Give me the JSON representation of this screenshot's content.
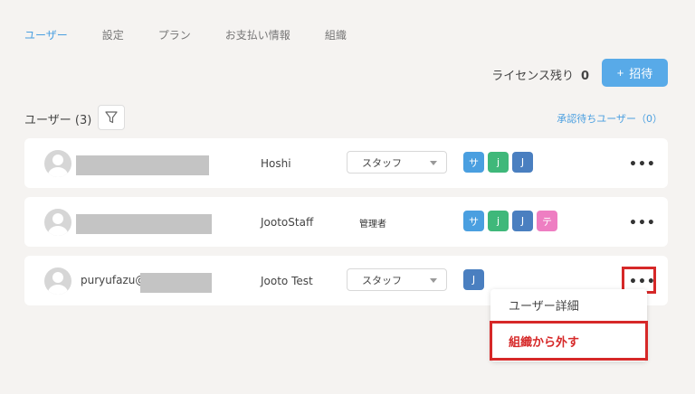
{
  "tabs": [
    {
      "label": "ユーザー",
      "active": true
    },
    {
      "label": "設定",
      "active": false
    },
    {
      "label": "プラン",
      "active": false
    },
    {
      "label": "お支払い情報",
      "active": false
    },
    {
      "label": "組織",
      "active": false
    }
  ],
  "license": {
    "label": "ライセンス残り",
    "count": "0"
  },
  "invite_button": {
    "plus": "+",
    "label": "招待"
  },
  "users_title": "ユーザー (3)",
  "pending_link": "承認待ちユーザー（0）",
  "rows": [
    {
      "email_prefix": "",
      "username": "Hoshi",
      "role": "スタッフ",
      "role_editable": true,
      "apps": [
        {
          "label": "サ"
        },
        {
          "label": "j"
        },
        {
          "label": "J"
        }
      ]
    },
    {
      "email_prefix": "",
      "username": "JootoStaff",
      "role": "管理者",
      "role_editable": false,
      "apps": [
        {
          "label": "サ"
        },
        {
          "label": "j"
        },
        {
          "label": "J"
        },
        {
          "label": "テ"
        }
      ]
    },
    {
      "email_prefix": "puryufazu@",
      "username": "Jooto Test",
      "role": "スタッフ",
      "role_editable": true,
      "apps": [
        {
          "label": "J"
        }
      ]
    }
  ],
  "more_label": "•••",
  "menu": {
    "detail": "ユーザー詳細",
    "remove": "組織から外す"
  },
  "colors": {
    "accent": "#58aae8",
    "highlight": "#d62828"
  }
}
